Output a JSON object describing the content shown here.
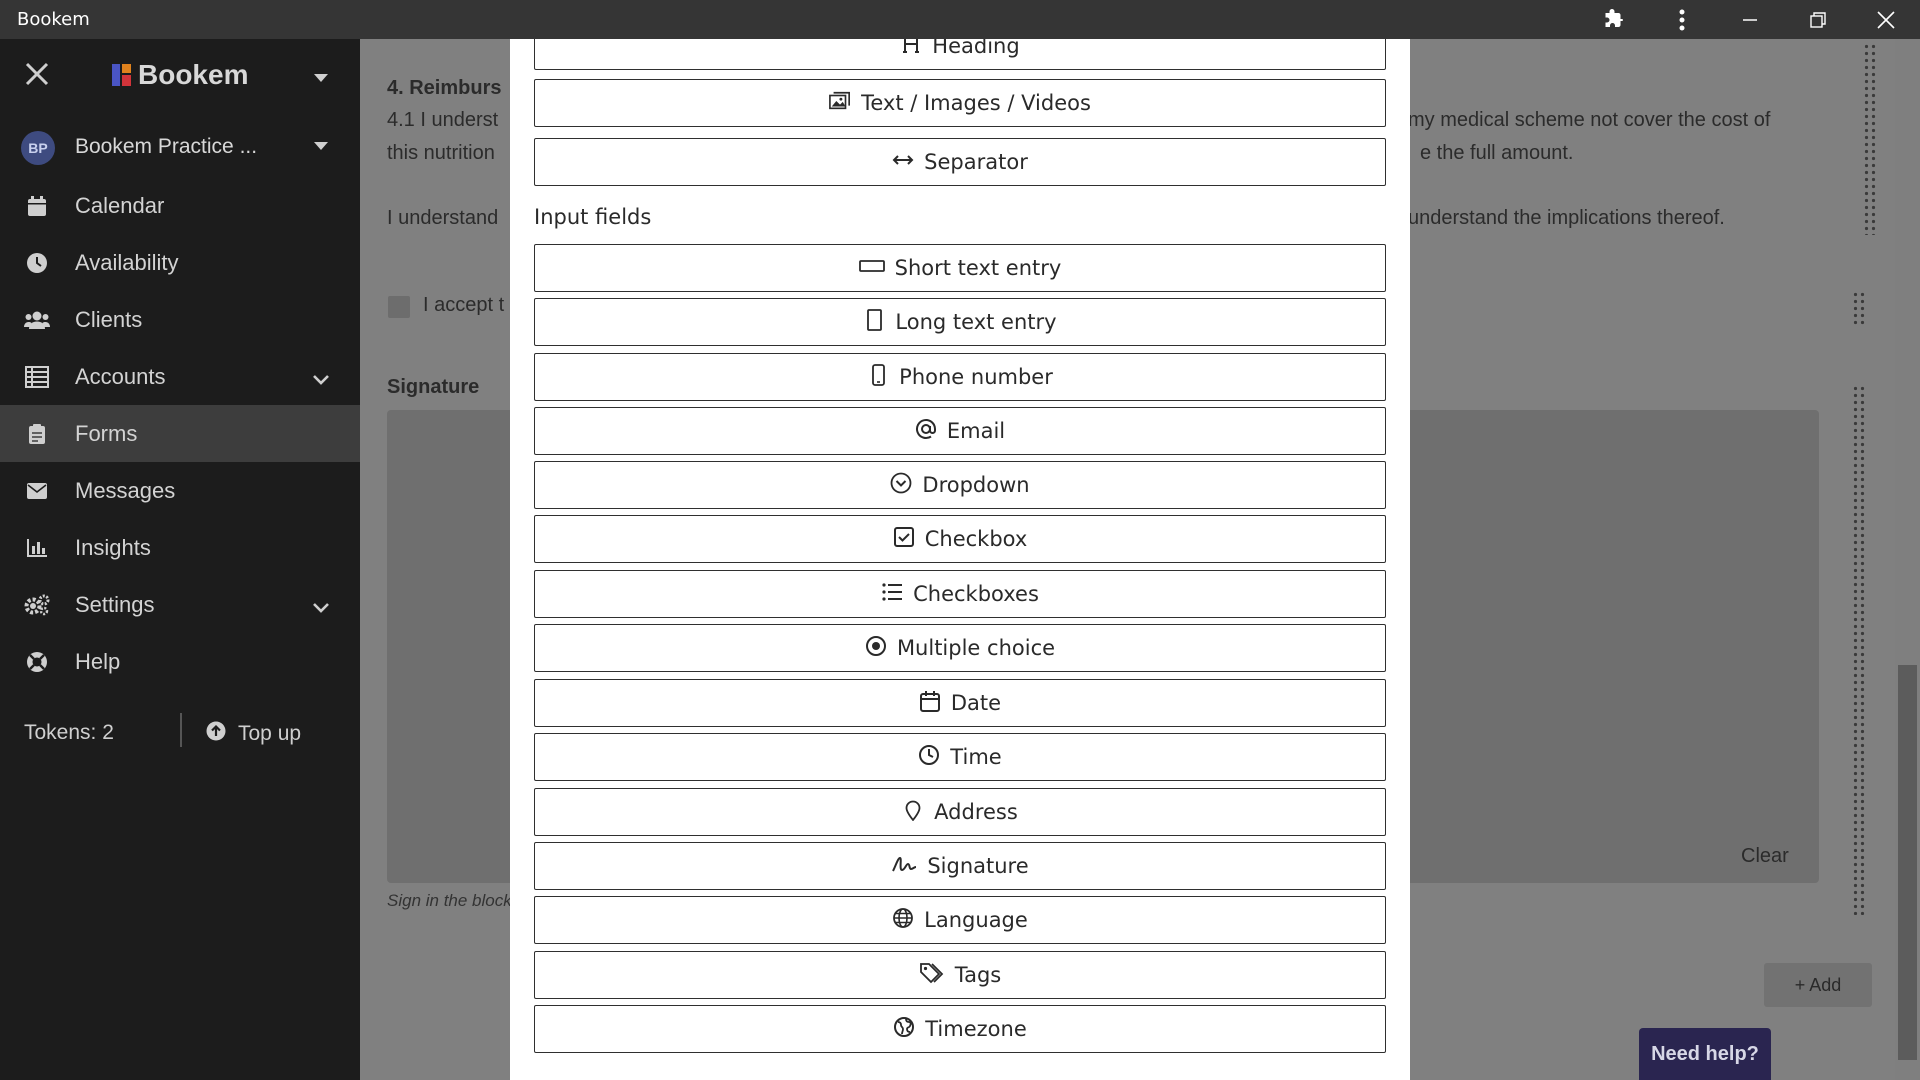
{
  "window": {
    "title": "Bookem"
  },
  "sidebar": {
    "brand": "Bookem",
    "account": {
      "initials": "BP",
      "name": "Bookem Practice ..."
    },
    "items": [
      {
        "label": "Calendar",
        "icon": "calendar-icon"
      },
      {
        "label": "Availability",
        "icon": "clock-icon"
      },
      {
        "label": "Clients",
        "icon": "users-icon"
      },
      {
        "label": "Accounts",
        "icon": "ledger-icon"
      },
      {
        "label": "Forms",
        "icon": "clipboard-icon"
      },
      {
        "label": "Messages",
        "icon": "envelope-icon"
      },
      {
        "label": "Insights",
        "icon": "bar-chart-icon"
      },
      {
        "label": "Settings",
        "icon": "gears-icon"
      },
      {
        "label": "Help",
        "icon": "lifebuoy-icon"
      }
    ],
    "tokens": "Tokens: 2",
    "topup": "Top up"
  },
  "background": {
    "section_heading": "4. Reimburs",
    "para1_left": "4.1 I underst",
    "para1_right": "my medical scheme not cover the cost of",
    "para2_left": "this nutrition",
    "para2_right": "e the full amount.",
    "para3_left": "I understand",
    "para3_right": "understand the implications thereof.",
    "accept_text": "I accept t",
    "signature_heading": "Signature",
    "clear_label": "Clear",
    "sign_hint": "Sign in the block",
    "add_label": "+ Add",
    "need_help": "Need help?"
  },
  "modal": {
    "top_buttons": [
      {
        "label": "Heading",
        "icon": "heading-icon"
      },
      {
        "label": "Text / Images / Videos",
        "icon": "images-icon"
      },
      {
        "label": "Separator",
        "icon": "arrows-horizontal-icon"
      }
    ],
    "input_fields_label": "Input fields",
    "input_buttons": [
      {
        "label": "Short text entry",
        "icon": "short-text-icon"
      },
      {
        "label": "Long text entry",
        "icon": "long-text-icon"
      },
      {
        "label": "Phone number",
        "icon": "phone-icon"
      },
      {
        "label": "Email",
        "icon": "at-icon"
      },
      {
        "label": "Dropdown",
        "icon": "chevron-circle-icon"
      },
      {
        "label": "Checkbox",
        "icon": "checkbox-icon"
      },
      {
        "label": "Checkboxes",
        "icon": "list-icon"
      },
      {
        "label": "Multiple choice",
        "icon": "radio-icon"
      },
      {
        "label": "Date",
        "icon": "calendar-icon"
      },
      {
        "label": "Time",
        "icon": "clock-icon"
      },
      {
        "label": "Address",
        "icon": "map-pin-icon"
      },
      {
        "label": "Signature",
        "icon": "signature-icon"
      },
      {
        "label": "Language",
        "icon": "globe-icon"
      },
      {
        "label": "Tags",
        "icon": "tags-icon"
      },
      {
        "label": "Timezone",
        "icon": "globe-americas-icon"
      }
    ]
  }
}
